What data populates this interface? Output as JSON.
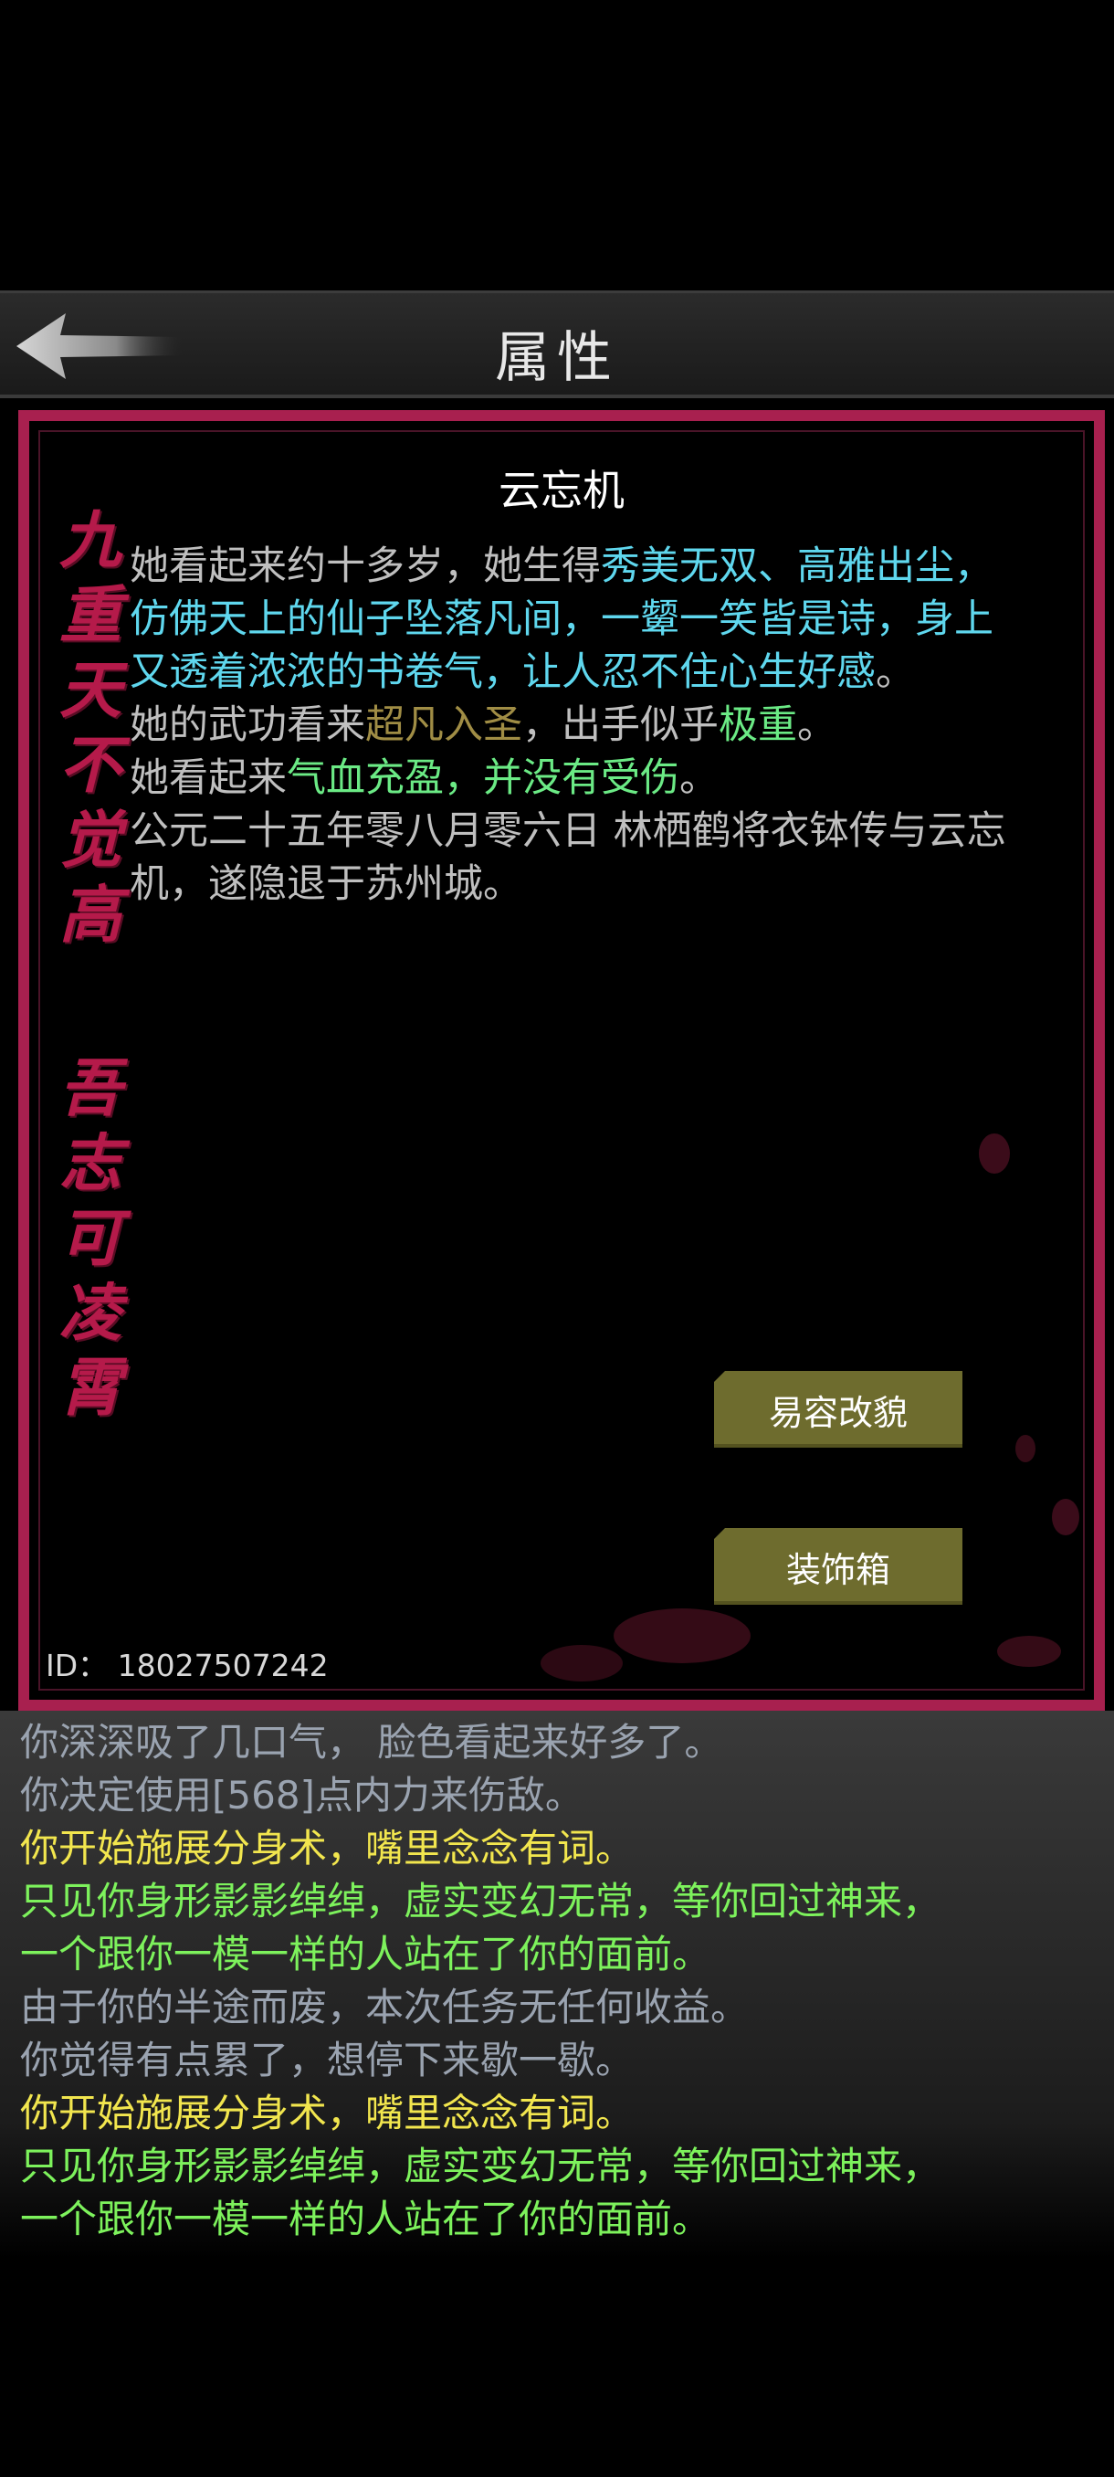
{
  "header": {
    "title": "属性"
  },
  "profile": {
    "name": "云忘机",
    "calligraphy_top": [
      "九",
      "重",
      "天",
      "不",
      "觉",
      "高"
    ],
    "calligraphy_bottom": [
      "吾",
      "志",
      "可",
      "凌",
      "霄"
    ],
    "desc": {
      "p1_a": "她看起来约十多岁，她生得",
      "p1_b": "秀美无双、高雅出尘，仿佛天上的仙子坠落凡间，一颦一笑皆是诗，身上又透着浓浓的书卷气，让人忍不住心生好感",
      "p1_c": "。",
      "p2_a": "她的武功看来",
      "p2_b": "超凡入圣",
      "p2_c": "，出手似乎",
      "p2_d": "极重",
      "p2_e": "。",
      "p3_a": "她看起来",
      "p3_b": "气血充盈，并没有受伤",
      "p3_c": "。",
      "p4": "公元二十五年零八月零六日 林栖鹤将衣钵传与云忘机，遂隐退于苏州城。"
    },
    "buttons": {
      "disguise": "易容改貌",
      "wardrobe": "装饰箱"
    },
    "id_text": "ID：  18027507242"
  },
  "log": [
    {
      "text": "你深深吸了几口气， 脸色看起来好多了。",
      "color": "grey"
    },
    {
      "text": "你决定使用[568]点内力来伤敌。",
      "color": "grey"
    },
    {
      "text": "你开始施展分身术，嘴里念念有词。",
      "color": "yellow"
    },
    {
      "text": "只见你身形影影绰绰，虚实变幻无常，等你回过神来，",
      "color": "green"
    },
    {
      "text": "一个跟你一模一样的人站在了你的面前。",
      "color": "green"
    },
    {
      "text": "由于你的半途而废，本次任务无任何收益。",
      "color": "grey"
    },
    {
      "text": "你觉得有点累了，想停下来歇一歇。",
      "color": "grey"
    },
    {
      "text": "你开始施展分身术，嘴里念念有词。",
      "color": "yellow"
    },
    {
      "text": "只见你身形影影绰绰，虚实变幻无常，等你回过神来，",
      "color": "green"
    },
    {
      "text": "一个跟你一模一样的人站在了你的面前。",
      "color": "green"
    }
  ],
  "icons": {
    "back": "back-arrow-icon"
  },
  "colors": {
    "frame": "#a8204f",
    "button": "#6e6c2e",
    "cyan": "#5fd7ee",
    "green": "#6bea85",
    "gold": "#a08d45"
  }
}
